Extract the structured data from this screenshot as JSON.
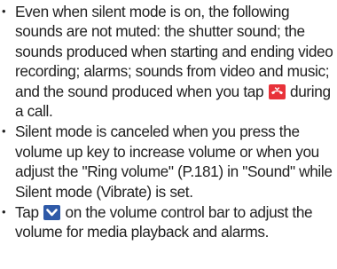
{
  "notes": [
    {
      "bullet": "•",
      "text_before": "Even when silent mode is on, the following sounds are not muted: the shutter sound; the sounds produced when starting and ending video recording; alarms; sounds from video and music; and the sound produced when you tap ",
      "icon": "end-call-icon",
      "text_after": " during a call."
    },
    {
      "bullet": "•",
      "text": "Silent mode is canceled when you press the volume up key to increase volume or when you adjust the \"Ring volume\" (P.181) in \"Sound\" while Silent mode (Vibrate) is set."
    },
    {
      "bullet": "•",
      "text_before": "Tap ",
      "icon": "chevron-down-icon",
      "text_after": " on the volume control bar to adjust the volume for media playback and alarms."
    }
  ],
  "colors": {
    "text": "#222222",
    "end_call_icon_bg": "#e8323a",
    "chevron_icon_bg": "#2f5aa8"
  }
}
